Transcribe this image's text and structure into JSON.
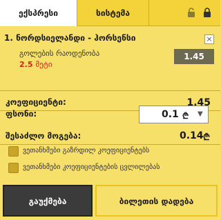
{
  "tabs": {
    "express": "ექსპრესი",
    "system": "სისტემა"
  },
  "bet": {
    "number": "1.",
    "event": "ნორდსიელანდი - ჰორსენსი",
    "market": "გოლების რაოდენობა",
    "line_value": "2.5",
    "line_unit": "მეტი",
    "odds": "1.45",
    "close": "×"
  },
  "summary": {
    "coef_label": "კოეფიციენტი:",
    "coef_value": "1.45",
    "stake_label": "ფსონი:",
    "stake_value": "0.1",
    "currency": "₾",
    "potential_label": "შესაძლო მოგება:",
    "potential_value": "0.14"
  },
  "options": {
    "accept_higher": "ვეთანხმები გაზრდილ კოეფიციენტებს",
    "accept_changes": "ვეთანხმები კოეფიციენტების ცვლილებას"
  },
  "buttons": {
    "cancel": "გაუქმება",
    "place": "ბილეთის დადება"
  },
  "colors": {
    "panel": "#f7e06a",
    "tab_bar": "#f3d23a",
    "odds_box": "#6e6a52",
    "line": "#d2231f",
    "checkbox": "#c9a62a",
    "cancel_bg": "#3b3b3b"
  }
}
